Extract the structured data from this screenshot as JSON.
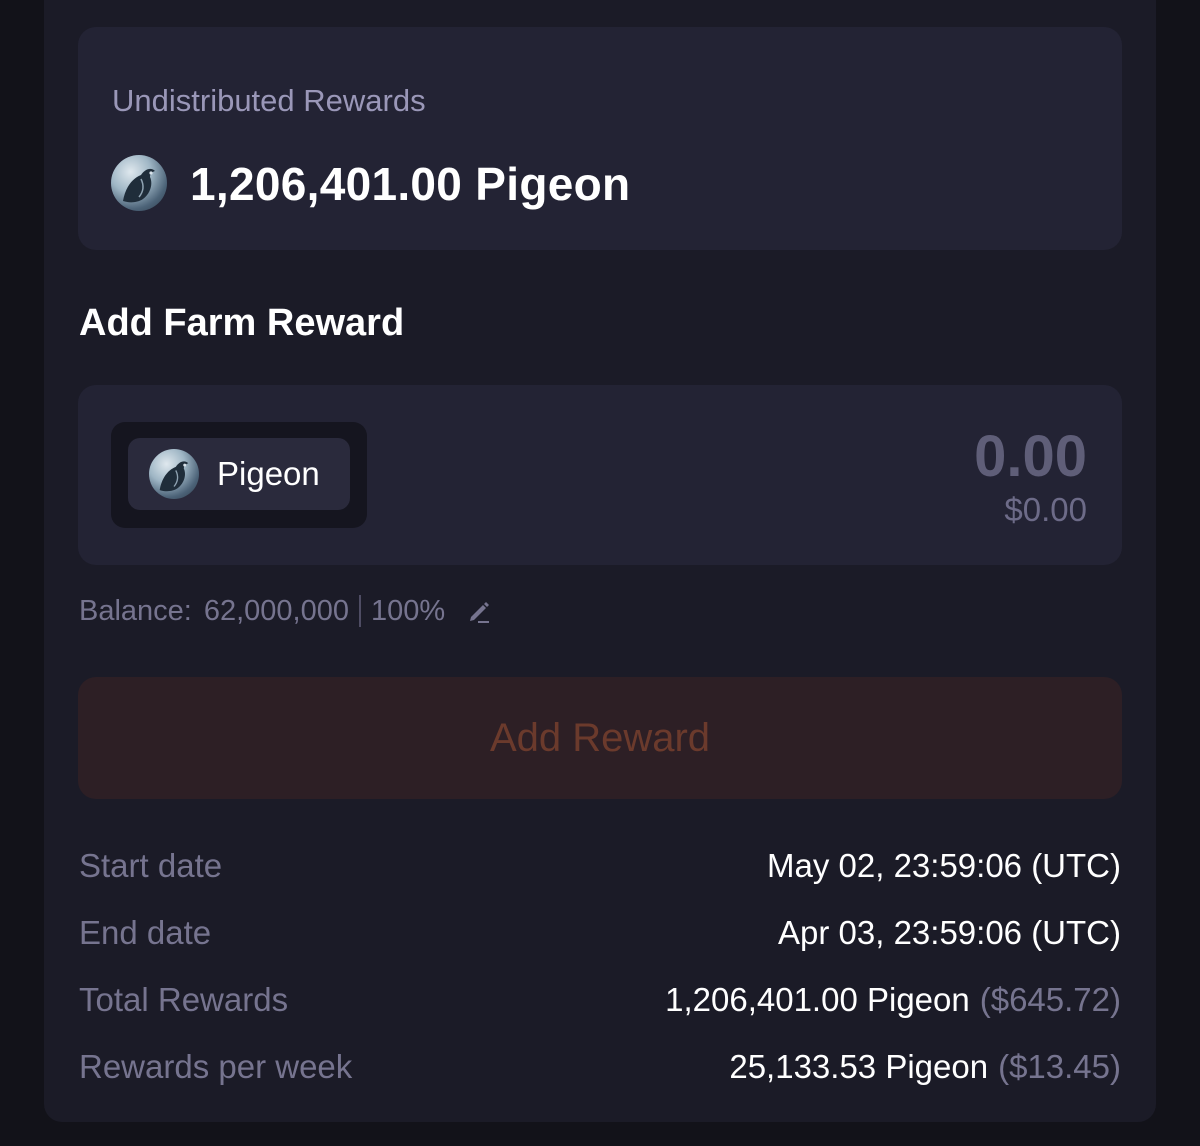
{
  "undistributed": {
    "label": "Undistributed Rewards",
    "amount": "1,206,401.00 Pigeon",
    "token_icon": "pigeon-token-icon"
  },
  "add_farm_reward": {
    "title": "Add Farm Reward",
    "token": {
      "symbol": "Pigeon",
      "icon": "pigeon-token-icon"
    },
    "amount_placeholder": "0.00",
    "amount_usd": "$0.00",
    "balance_label": "Balance:",
    "balance_value": "62,000,000",
    "balance_percent": "100%",
    "edit_icon": "pencil-icon",
    "button_label": "Add Reward"
  },
  "details": [
    {
      "label": "Start date",
      "value": "May 02, 23:59:06 (UTC)",
      "usd": ""
    },
    {
      "label": "End date",
      "value": "Apr 03, 23:59:06 (UTC)",
      "usd": ""
    },
    {
      "label": "Total Rewards",
      "value": "1,206,401.00 Pigeon",
      "usd": "($645.72)"
    },
    {
      "label": "Rewards per week",
      "value": "25,133.53 Pigeon",
      "usd": "($13.45)"
    }
  ],
  "colors": {
    "background": "#121219",
    "panel": "#1b1b27",
    "card": "#232334",
    "muted_text": "#76748f",
    "button_bg": "#2d1f25",
    "button_text": "#6b3a2c"
  }
}
